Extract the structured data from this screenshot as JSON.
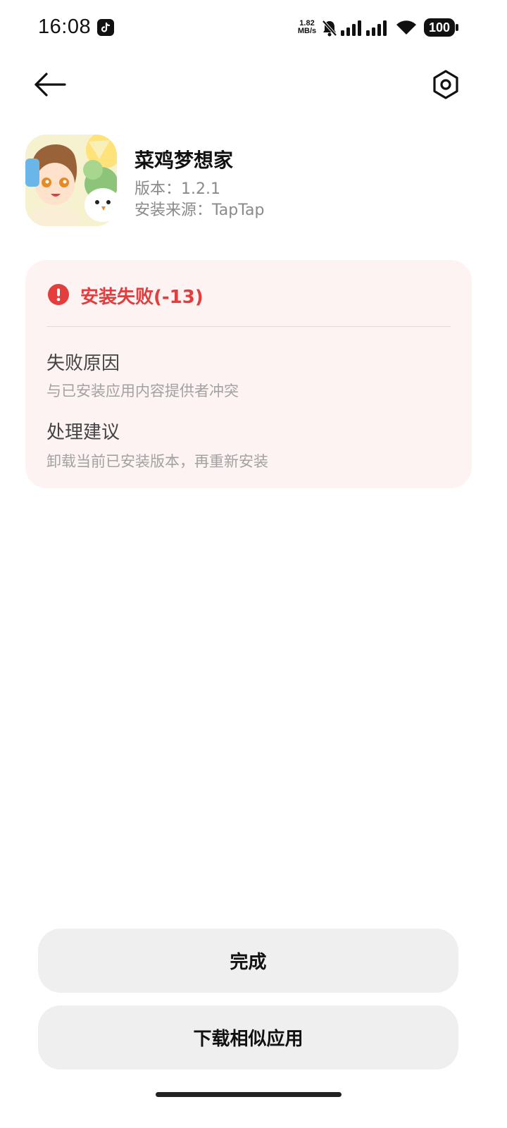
{
  "status_bar": {
    "time": "16:08",
    "net_speed_value": "1.82",
    "net_speed_unit": "MB/s",
    "battery": "100"
  },
  "top_bar": {
    "back_icon": "arrow-left-icon",
    "settings_icon": "hexagon-settings-icon"
  },
  "app": {
    "name": "菜鸡梦想家",
    "version": "版本：1.2.1",
    "source": "安装来源：TapTap"
  },
  "error": {
    "title": "安装失败(-13)",
    "color": "#e33d3d",
    "reason_label": "失败原因",
    "reason_text": "与已安装应用内容提供者冲突",
    "advice_label": "处理建议",
    "advice_text": "卸载当前已安装版本，再重新安装"
  },
  "actions": {
    "done_label": "完成",
    "similar_label": "下载相似应用"
  }
}
